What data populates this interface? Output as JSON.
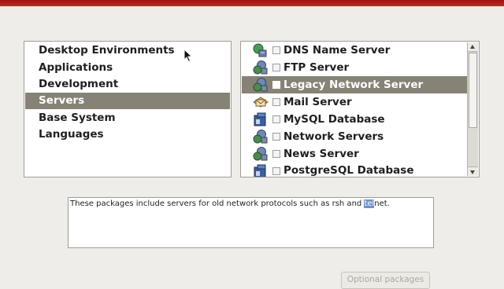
{
  "categories": {
    "items": [
      {
        "label": "Desktop Environments",
        "selected": false
      },
      {
        "label": "Applications",
        "selected": false
      },
      {
        "label": "Development",
        "selected": false
      },
      {
        "label": "Servers",
        "selected": true
      },
      {
        "label": "Base System",
        "selected": false
      },
      {
        "label": "Languages",
        "selected": false
      }
    ]
  },
  "packages": {
    "items": [
      {
        "label": "DNS Name Server",
        "icon": "dns-server-icon",
        "checked": false,
        "selected": false
      },
      {
        "label": "FTP Server",
        "icon": "network-server-icon",
        "checked": false,
        "selected": false
      },
      {
        "label": "Legacy Network Server",
        "icon": "network-server-icon",
        "checked": false,
        "selected": true
      },
      {
        "label": "Mail Server",
        "icon": "mail-server-icon",
        "checked": false,
        "selected": false
      },
      {
        "label": "MySQL Database",
        "icon": "database-icon",
        "checked": false,
        "selected": false
      },
      {
        "label": "Network Servers",
        "icon": "network-server-icon",
        "checked": false,
        "selected": false
      },
      {
        "label": "News Server",
        "icon": "network-server-icon",
        "checked": false,
        "selected": false
      },
      {
        "label": "PostgreSQL Database",
        "icon": "database-icon",
        "checked": false,
        "selected": false
      }
    ]
  },
  "description": {
    "before": "These packages include servers for old network protocols such as rsh and ",
    "highlight": "tel",
    "after": "net."
  },
  "buttons": {
    "optional_packages": "Optional packages"
  },
  "colors": {
    "selection": "#868275",
    "banner": "#b3201c",
    "text_highlight": "#6f93c8"
  }
}
